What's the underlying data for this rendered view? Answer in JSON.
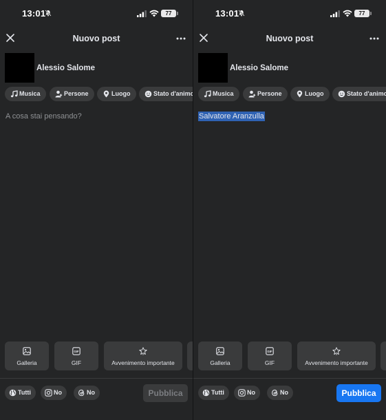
{
  "status": {
    "time": "13:01",
    "battery": "77"
  },
  "colors": {
    "accent": "#1877f2",
    "background": "#242526",
    "chip": "#3a3b3c",
    "selection": "#2f62b3"
  },
  "header": {
    "title": "Nuovo post",
    "close_icon": "close-icon",
    "more_icon": "more-icon"
  },
  "user": {
    "name": "Alessio Salome"
  },
  "chips": [
    {
      "label": "Musica",
      "icon": "music-icon"
    },
    {
      "label": "Persone",
      "icon": "person-icon"
    },
    {
      "label": "Luogo",
      "icon": "location-icon"
    },
    {
      "label": "Stato d'animo",
      "icon": "emoji-icon"
    }
  ],
  "composer": {
    "placeholder": "A cosa stai pensando?",
    "typed_text": "Salvatore Aranzulla"
  },
  "tools": [
    {
      "label": "Galleria",
      "icon": "gallery-icon"
    },
    {
      "label": "GIF",
      "icon": "gif-icon"
    },
    {
      "label": "Avvenimento importante",
      "icon": "star-icon"
    }
  ],
  "audience": [
    {
      "label": "Tutti",
      "icon": "globe-icon"
    },
    {
      "label": "No",
      "icon": "instagram-icon"
    },
    {
      "label": "No",
      "icon": "threads-icon"
    }
  ],
  "publish": {
    "label": "Pubblica"
  }
}
